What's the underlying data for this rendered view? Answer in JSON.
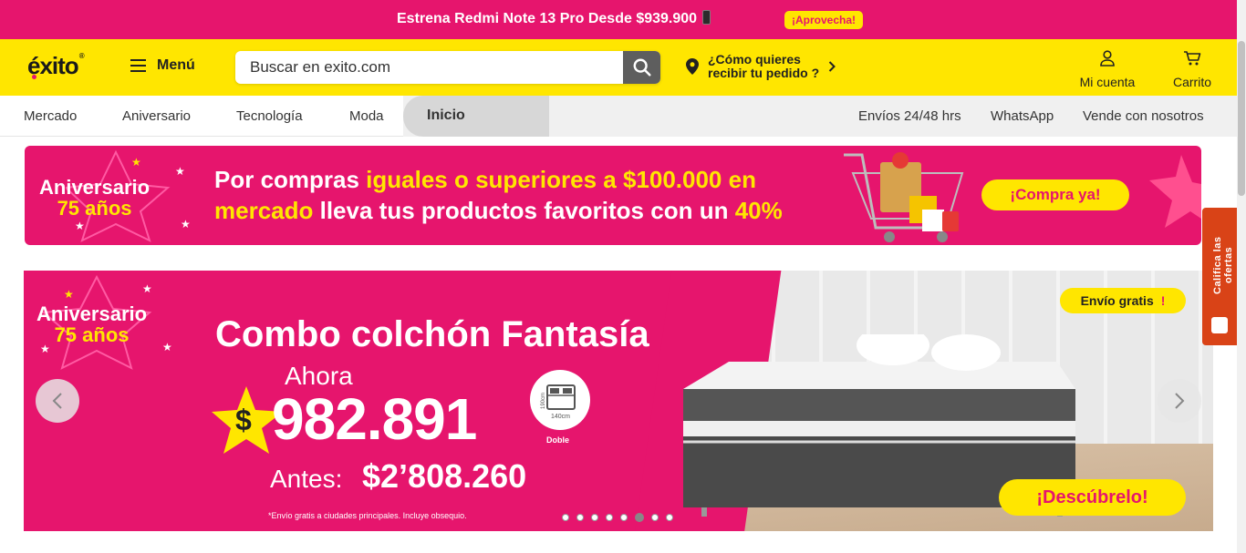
{
  "promo": {
    "text": "Estrena Redmi Note 13 Pro Desde $939.900",
    "button": "¡Aprovecha!"
  },
  "header": {
    "logo": "éxito",
    "menu_label": "Menú",
    "search_placeholder": "Buscar en exito.com",
    "delivery_line1": "¿Cómo quieres",
    "delivery_line2": "recibir tu pedido ?",
    "account_label": "Mi cuenta",
    "cart_label": "Carrito"
  },
  "nav": {
    "items": [
      "Mercado",
      "Aniversario",
      "Tecnología",
      "Moda"
    ],
    "active": "Inicio",
    "right": [
      "Envíos 24/48 hrs",
      "WhatsApp",
      "Vende con nosotros"
    ]
  },
  "banner1": {
    "anniv_line1": "Aniversario",
    "anniv_line2": "75 años",
    "text_a": "Por compras ",
    "text_b": "iguales o superiores a $100.000 en",
    "text_c": "mercado",
    "text_d": " lleva tus productos favoritos con un ",
    "text_e": "40%",
    "button": "¡Compra ya!"
  },
  "hero": {
    "anniv_line1": "Aniversario",
    "anniv_line2": "75 años",
    "title": "Combo colchón Fantasía",
    "ahora": "Ahora",
    "currency": "$",
    "price": "982.891",
    "antes_label": "Antes:",
    "antes_value": "$2’808.260",
    "disclaimer": "*Envío gratis a ciudades principales. Incluye obsequio.",
    "size_w": "140cm",
    "size_h": "190cm",
    "size_label": "Doble",
    "envio": "Envío gratis",
    "cta": "¡Descúbrelo!",
    "slides_total": 8,
    "slide_active": 6
  },
  "side_tab": {
    "text": "Califica las ofertas"
  },
  "colors": {
    "pink": "#e6156d",
    "yellow": "#ffe600",
    "side_tab": "#d94317"
  }
}
